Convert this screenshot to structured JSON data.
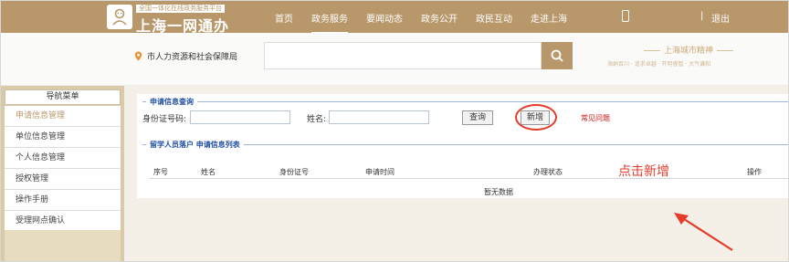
{
  "header": {
    "logo_subtitle": "全国一体化在线政务服务平台",
    "logo_title": "上海一网通办",
    "nav": [
      "首页",
      "政务服务",
      "要闻动态",
      "政务公开",
      "政民互动",
      "走进上海"
    ],
    "active_nav": "政务服务",
    "separator": "|",
    "logout": "退出"
  },
  "department": {
    "location_icon": "map-pin-icon",
    "name": "市人力资源和社会保障局",
    "search_placeholder": ""
  },
  "guide": {
    "title": "上海城市精神",
    "tags": "海纳百川 · 追求卓越 · 开明睿智 · 大气谦和"
  },
  "sidebar": {
    "header": "导航菜单",
    "items": [
      {
        "label": "申请信息管理",
        "active": true
      },
      {
        "label": "单位信息管理"
      },
      {
        "label": "个人信息管理"
      },
      {
        "label": "授权管理"
      },
      {
        "label": "操作手册"
      },
      {
        "label": "受理网点确认"
      }
    ]
  },
  "query": {
    "legend": "申请信息查询",
    "id_label": "身份证号码:",
    "id_value": "",
    "name_label": "姓名:",
    "name_value": "",
    "query_button": "查询",
    "add_button": "新增",
    "faq_link": "常见问题"
  },
  "list": {
    "legend_prefix": "留学人员落户",
    "legend_suffix": "申请信息列表",
    "columns": [
      "序号",
      "姓名",
      "身份证号",
      "申请时间",
      "办理状态",
      "操作"
    ],
    "empty_text": "暂无数据"
  },
  "annotation": {
    "text": "点击新增"
  },
  "colors": {
    "brand": "#b8986a",
    "annotation": "#e43b2a",
    "link_blue": "#1f4fa3"
  }
}
